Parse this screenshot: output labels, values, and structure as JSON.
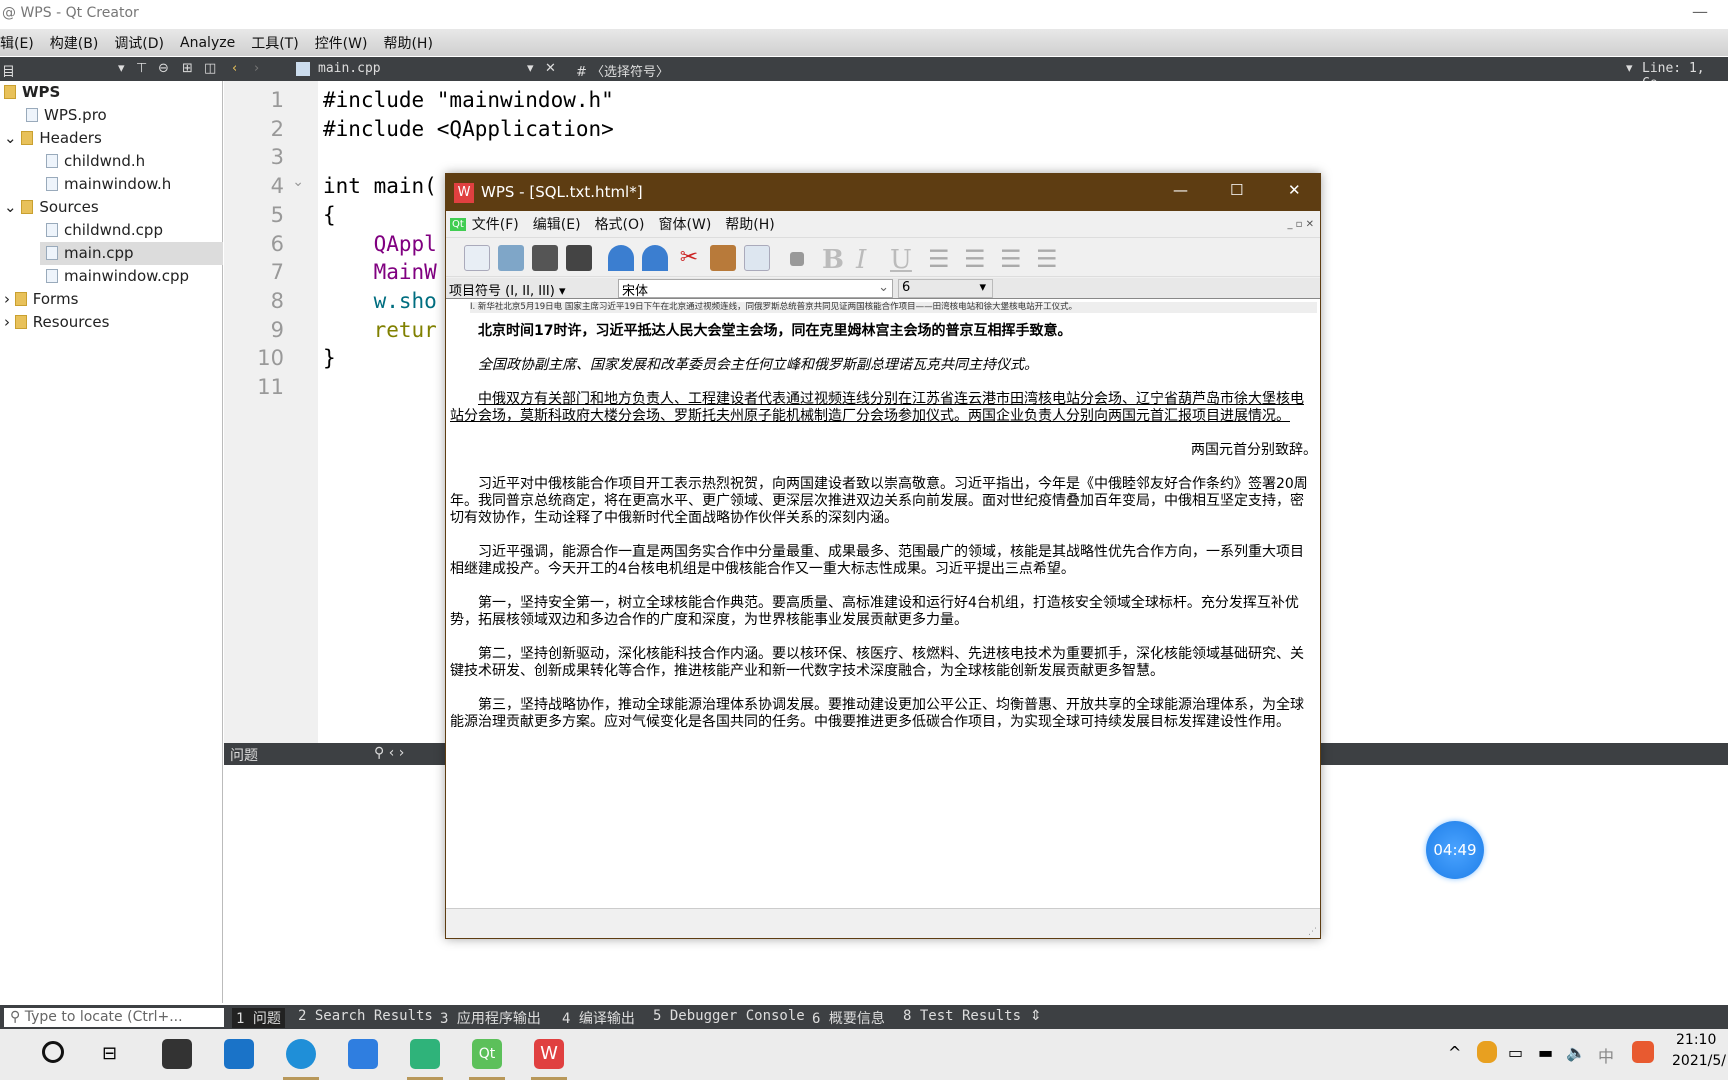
{
  "qt": {
    "title": "@ WPS - Qt Creator",
    "menu": [
      "辑(E)",
      "构建(B)",
      "调试(D)",
      "Analyze",
      "工具(T)",
      "控件(W)",
      "帮助(H)"
    ],
    "toolbar": {
      "project_label": "目",
      "file": "main.cpp",
      "symbol": "#  〈选择符号〉",
      "position": "Line: 1, Co"
    },
    "tree": [
      {
        "label": "WPS",
        "bold": true
      },
      {
        "label": "WPS.pro"
      },
      {
        "label": "Headers"
      },
      {
        "label": "childwnd.h"
      },
      {
        "label": "mainwindow.h"
      },
      {
        "label": "Sources"
      },
      {
        "label": "childwnd.cpp"
      },
      {
        "label": "main.cpp",
        "selected": true
      },
      {
        "label": "mainwindow.cpp"
      },
      {
        "label": "Forms"
      },
      {
        "label": "Resources"
      }
    ],
    "code": [
      "#include \"mainwindow.h\"",
      "#include <QApplication>",
      "",
      "int main(",
      "{",
      "    QAppl",
      "    MainW",
      "    w.sho",
      "    retur",
      "}",
      ""
    ],
    "panel_title": "问题",
    "locate_placeholder": "Type to locate (Ctrl+...",
    "output_tabs": [
      "1 问题",
      "2 Search Results",
      "3 应用程序输出",
      "4 编译输出",
      "5 Debugger Console",
      "6 概要信息",
      "8 Test Results"
    ]
  },
  "wps": {
    "title": "WPS - [SQL.txt.html*]",
    "menu": [
      "文件(F)",
      "编辑(E)",
      "格式(O)",
      "窗体(W)",
      "帮助(H)"
    ],
    "list_style": "项目符号 (I, II, III)",
    "font": "宋体",
    "size": "6",
    "doc": {
      "first_line": "I. 新华社北京5月19日电 国家主席习近平19日下午在北京通过视频连线，同俄罗斯总统普京共同见证两国核能合作项目——田湾核电站和徐大堡核电站开工仪式。",
      "bold": "北京时间17时许，习近平抵达人民大会堂主会场，同在克里姆林宫主会场的普京互相挥手致意。",
      "italic": "全国政协副主席、国家发展和改革委员会主任何立峰和俄罗斯副总理诺瓦克共同主持仪式。",
      "underline": "中俄双方有关部门和地方负责人、工程建设者代表通过视频连线分别在江苏省连云港市田湾核电站分会场、辽宁省葫芦岛市徐大堡核电站分会场，莫斯科政府大楼分会场、罗斯托夫州原子能机械制造厂分会场参加仪式。两国企业负责人分别向两国元首汇报项目进展情况。",
      "right": "两国元首分别致辞。",
      "p1": "习近平对中俄核能合作项目开工表示热烈祝贺，向两国建设者致以崇高敬意。习近平指出，今年是《中俄睦邻友好合作条约》签署20周年。我同普京总统商定，将在更高水平、更广领域、更深层次推进双边关系向前发展。面对世纪疫情叠加百年变局，中俄相互坚定支持，密切有效协作，生动诠释了中俄新时代全面战略协作伙伴关系的深刻内涵。",
      "p2": "习近平强调，能源合作一直是两国务实合作中分量最重、成果最多、范围最广的领域，核能是其战略性优先合作方向，一系列重大项目相继建成投产。今天开工的4台核电机组是中俄核能合作又一重大标志性成果。习近平提出三点希望。",
      "p3": "第一，坚持安全第一，树立全球核能合作典范。要高质量、高标准建设和运行好4台机组，打造核安全领域全球标杆。充分发挥互补优势，拓展核领域双边和多边合作的广度和深度，为世界核能事业发展贡献更多力量。",
      "p4": "第二，坚持创新驱动，深化核能科技合作内涵。要以核环保、核医疗、核燃料、先进核电技术为重要抓手，深化核能领域基础研究、关键技术研发、创新成果转化等合作，推进核能产业和新一代数字技术深度融合，为全球核能创新发展贡献更多智慧。",
      "p5": "第三，坚持战略协作，推动全球能源治理体系协调发展。要推动建设更加公平公正、均衡普惠、开放共享的全球能源治理体系，为全球能源治理贡献更多方案。应对气候变化是各国共同的任务。中俄要推进更多低碳合作项目，为实现全球可持续发展目标发挥建设性作用。"
    }
  },
  "timer": "04:49",
  "tray": {
    "ime": "中",
    "time": "21:10",
    "date": "2021/5/"
  }
}
